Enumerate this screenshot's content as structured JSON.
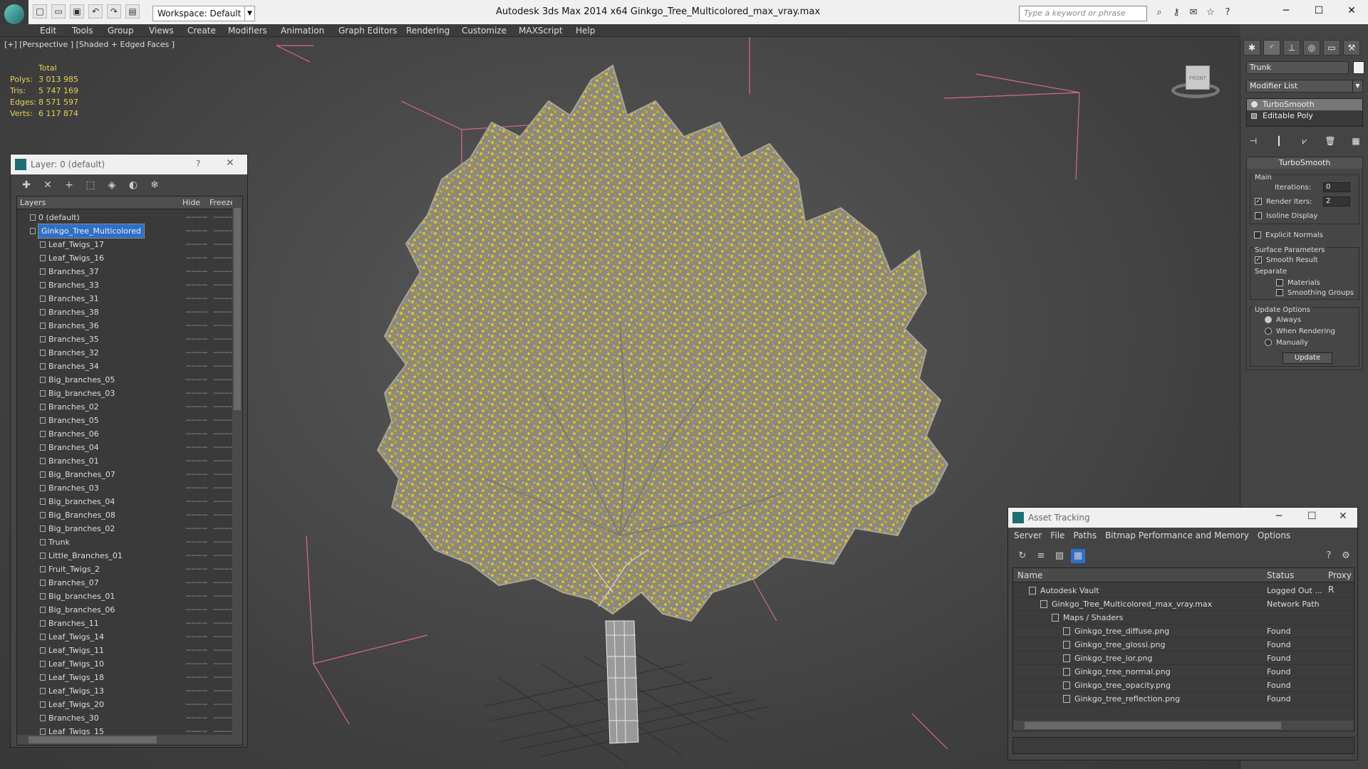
{
  "window": {
    "app_title": "Autodesk 3ds Max  2014 x64       Ginkgo_Tree_Multicolored_max_vray.max",
    "workspace": "Workspace: Default",
    "search_placeholder": "Type a keyword or phrase"
  },
  "menu": [
    "Edit",
    "Tools",
    "Group",
    "Views",
    "Create",
    "Modifiers",
    "Animation",
    "Graph Editors",
    "Rendering",
    "Customize",
    "MAXScript",
    "Help"
  ],
  "viewport": {
    "label": "[+] [Perspective ] [Shaded + Edged Faces ]",
    "stats_header": "Total",
    "stats": [
      {
        "k": "Polys:",
        "v": "3 013 985"
      },
      {
        "k": "Tris:",
        "v": "5 747 169"
      },
      {
        "k": "Edges:",
        "v": "8 571 597"
      },
      {
        "k": "Verts:",
        "v": "6 117 874"
      }
    ],
    "viewcube_label": "FRONT",
    "colors": {
      "foliage": "#d6b820",
      "twigs": "#8a8a8a",
      "bbox": "#d86a8a"
    }
  },
  "layer_panel": {
    "title": "Layer: 0 (default)",
    "help": "?",
    "columns": {
      "layers": "Layers",
      "hide": "Hide",
      "freeze": "Freeze"
    },
    "rows": [
      {
        "name": "0 (default)",
        "level": 0,
        "hide": "────",
        "freeze": "────"
      },
      {
        "name": "Ginkgo_Tree_Multicolored",
        "level": 0,
        "hide": "────",
        "freeze": "────",
        "selected": true
      },
      {
        "name": "Leaf_Twigs_17",
        "level": 1,
        "hide": "────",
        "freeze": "────"
      },
      {
        "name": "Leaf_Twigs_16",
        "level": 1,
        "hide": "────",
        "freeze": "────"
      },
      {
        "name": "Branches_37",
        "level": 1,
        "hide": "────",
        "freeze": "────"
      },
      {
        "name": "Branches_33",
        "level": 1,
        "hide": "────",
        "freeze": "────"
      },
      {
        "name": "Branches_31",
        "level": 1,
        "hide": "────",
        "freeze": "────"
      },
      {
        "name": "Branches_38",
        "level": 1,
        "hide": "────",
        "freeze": "────"
      },
      {
        "name": "Branches_36",
        "level": 1,
        "hide": "────",
        "freeze": "────"
      },
      {
        "name": "Branches_35",
        "level": 1,
        "hide": "────",
        "freeze": "────"
      },
      {
        "name": "Branches_32",
        "level": 1,
        "hide": "────",
        "freeze": "────"
      },
      {
        "name": "Branches_34",
        "level": 1,
        "hide": "────",
        "freeze": "────"
      },
      {
        "name": "Big_branches_05",
        "level": 1,
        "hide": "────",
        "freeze": "────"
      },
      {
        "name": "Big_branches_03",
        "level": 1,
        "hide": "────",
        "freeze": "────"
      },
      {
        "name": "Branches_02",
        "level": 1,
        "hide": "────",
        "freeze": "────"
      },
      {
        "name": "Branches_05",
        "level": 1,
        "hide": "────",
        "freeze": "────"
      },
      {
        "name": "Branches_06",
        "level": 1,
        "hide": "────",
        "freeze": "────"
      },
      {
        "name": "Branches_04",
        "level": 1,
        "hide": "────",
        "freeze": "────"
      },
      {
        "name": "Branches_01",
        "level": 1,
        "hide": "────",
        "freeze": "────"
      },
      {
        "name": "Big_Branches_07",
        "level": 1,
        "hide": "────",
        "freeze": "────"
      },
      {
        "name": "Branches_03",
        "level": 1,
        "hide": "────",
        "freeze": "────"
      },
      {
        "name": "Big_branches_04",
        "level": 1,
        "hide": "────",
        "freeze": "────"
      },
      {
        "name": "Big_Branches_08",
        "level": 1,
        "hide": "────",
        "freeze": "────"
      },
      {
        "name": "Big_branches_02",
        "level": 1,
        "hide": "────",
        "freeze": "────"
      },
      {
        "name": "Trunk",
        "level": 1,
        "hide": "────",
        "freeze": "────"
      },
      {
        "name": "Little_Branches_01",
        "level": 1,
        "hide": "────",
        "freeze": "────"
      },
      {
        "name": "Fruit_Twigs_2",
        "level": 1,
        "hide": "────",
        "freeze": "────"
      },
      {
        "name": "Branches_07",
        "level": 1,
        "hide": "────",
        "freeze": "────"
      },
      {
        "name": "Big_branches_01",
        "level": 1,
        "hide": "────",
        "freeze": "────"
      },
      {
        "name": "Big_branches_06",
        "level": 1,
        "hide": "────",
        "freeze": "────"
      },
      {
        "name": "Branches_11",
        "level": 1,
        "hide": "────",
        "freeze": "────"
      },
      {
        "name": "Leaf_Twigs_14",
        "level": 1,
        "hide": "────",
        "freeze": "────"
      },
      {
        "name": "Leaf_Twigs_11",
        "level": 1,
        "hide": "────",
        "freeze": "────"
      },
      {
        "name": "Leaf_Twigs_10",
        "level": 1,
        "hide": "────",
        "freeze": "────"
      },
      {
        "name": "Leaf_Twigs_18",
        "level": 1,
        "hide": "────",
        "freeze": "────"
      },
      {
        "name": "Leaf_Twigs_13",
        "level": 1,
        "hide": "────",
        "freeze": "────"
      },
      {
        "name": "Leaf_Twigs_20",
        "level": 1,
        "hide": "────",
        "freeze": "────"
      },
      {
        "name": "Branches_30",
        "level": 1,
        "hide": "────",
        "freeze": "────"
      },
      {
        "name": "Leaf_Twigs_15",
        "level": 1,
        "hide": "────",
        "freeze": "────"
      }
    ]
  },
  "command_panel": {
    "object_name": "Trunk",
    "modifier_list": "Modifier List",
    "stack": [
      {
        "name": "TurboSmooth",
        "selected": true
      },
      {
        "name": "Editable Poly",
        "selected": false
      }
    ],
    "rollout_title": "TurboSmooth",
    "main_group": "Main",
    "iterations_label": "Iterations:",
    "iterations_value": "0",
    "render_iters_label": "Render Iters:",
    "render_iters_value": "2",
    "isoline": "Isoline Display",
    "explicit_normals": "Explicit Normals",
    "surface_group": "Surface Parameters",
    "smooth_result": "Smooth Result",
    "separate": "Separate",
    "materials": "Materials",
    "smoothing_groups": "Smoothing Groups",
    "update_group": "Update Options",
    "always": "Always",
    "when_rendering": "When Rendering",
    "manually": "Manually",
    "update_button": "Update"
  },
  "asset_panel": {
    "title": "Asset Tracking",
    "menu": [
      "Server",
      "File",
      "Paths",
      "Bitmap Performance and Memory",
      "Options"
    ],
    "columns": {
      "name": "Name",
      "status": "Status",
      "proxy": "Proxy R"
    },
    "rows": [
      {
        "name": "Autodesk Vault",
        "status": "Logged Out ...",
        "indent": 0
      },
      {
        "name": "Ginkgo_Tree_Multicolored_max_vray.max",
        "status": "Network Path",
        "indent": 1
      },
      {
        "name": "Maps / Shaders",
        "status": "",
        "indent": 2
      },
      {
        "name": "Ginkgo_tree_diffuse.png",
        "status": "Found",
        "indent": 3
      },
      {
        "name": "Ginkgo_tree_glossi.png",
        "status": "Found",
        "indent": 3
      },
      {
        "name": "Ginkgo_tree_ior.png",
        "status": "Found",
        "indent": 3
      },
      {
        "name": "Ginkgo_tree_normal.png",
        "status": "Found",
        "indent": 3
      },
      {
        "name": "Ginkgo_tree_opacity.png",
        "status": "Found",
        "indent": 3
      },
      {
        "name": "Ginkgo_tree_reflection.png",
        "status": "Found",
        "indent": 3
      }
    ]
  }
}
